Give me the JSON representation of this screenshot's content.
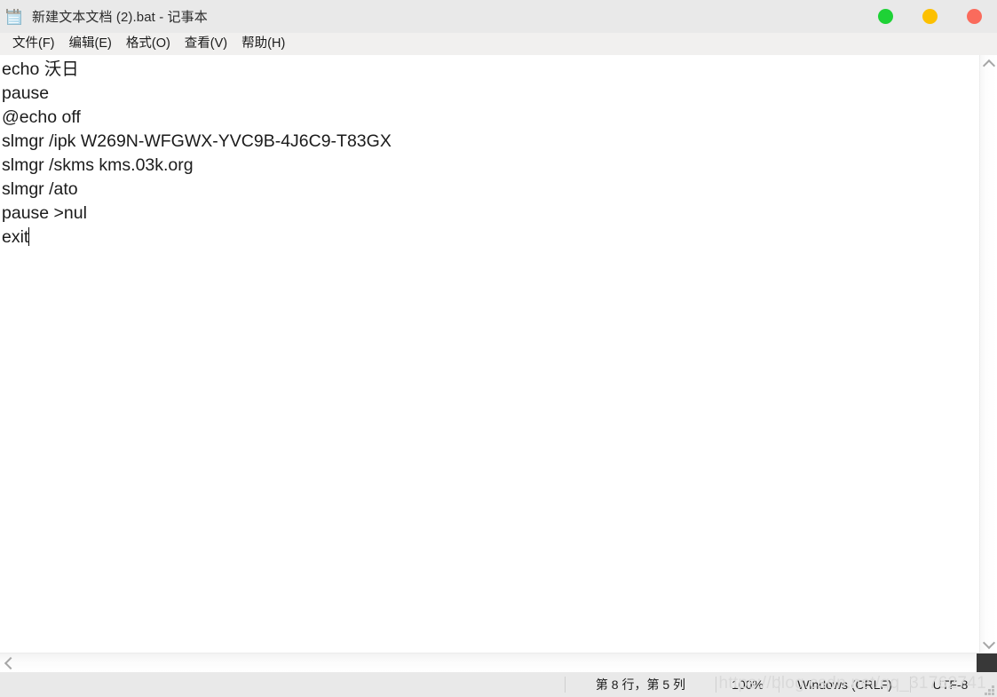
{
  "window": {
    "title": "新建文本文档 (2).bat - 记事本",
    "icon": "notepad-icon",
    "controls": [
      {
        "name": "minimize",
        "label": "",
        "color": "#1ed236"
      },
      {
        "name": "maximize",
        "label": "",
        "color": "#fcc000"
      },
      {
        "name": "close",
        "label": "",
        "color": "#fa6b5c"
      }
    ]
  },
  "menubar": {
    "items": [
      {
        "label": "文件(F)",
        "name": "file"
      },
      {
        "label": "编辑(E)",
        "name": "edit"
      },
      {
        "label": "格式(O)",
        "name": "format"
      },
      {
        "label": "查看(V)",
        "name": "view"
      },
      {
        "label": "帮助(H)",
        "name": "help"
      }
    ]
  },
  "editor": {
    "lines": [
      "echo 沃日",
      "pause",
      "@echo off",
      "slmgr /ipk W269N-WFGWX-YVC9B-4J6C9-T83GX",
      "slmgr /skms kms.03k.org",
      "slmgr /ato",
      "pause >nul",
      "exit"
    ],
    "caret_line": 8,
    "caret_column": 5
  },
  "scrollbars": {
    "vertical": {
      "up_icon": "chevron-up-icon",
      "down_icon": "chevron-down-icon"
    },
    "horizontal": {
      "left_icon": "chevron-left-icon",
      "right_icon": "chevron-right-icon"
    }
  },
  "statusbar": {
    "position": "第 8 行，第 5 列",
    "zoom": "100%",
    "line_ending": "Windows (CRLF)",
    "encoding": "UTF-8"
  },
  "watermark": {
    "text": "https://blog.csdn.net/qq_31762741"
  }
}
